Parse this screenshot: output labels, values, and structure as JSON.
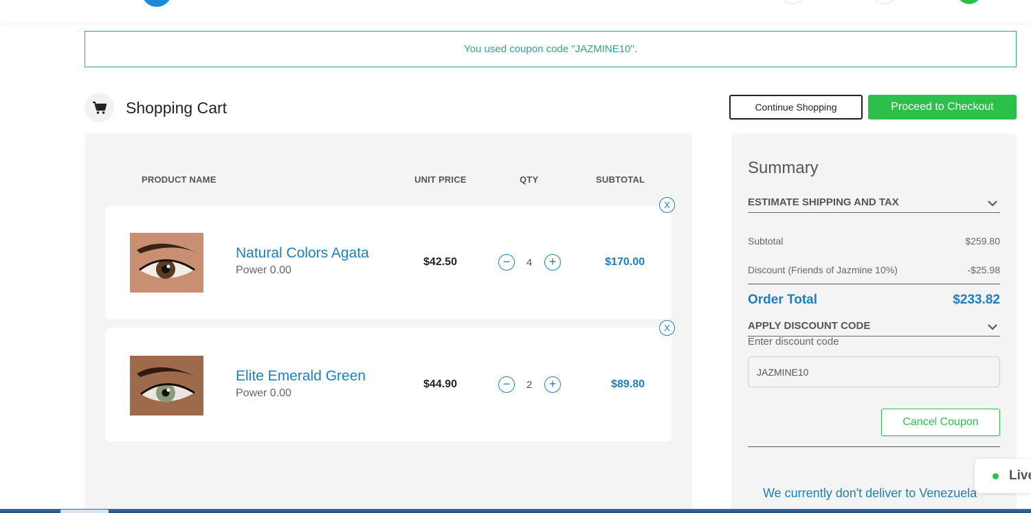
{
  "banner": {
    "message": "You used coupon code \"JAZMINE10\"."
  },
  "header": {
    "cart_icon": "cart-icon",
    "title": "Shopping Cart",
    "continue_label": "Continue Shopping",
    "checkout_label": "Proceed to Checkout"
  },
  "table": {
    "columns": [
      "PRODUCT NAME",
      "UNIT PRICE",
      "QTY",
      "SUBTOTAL"
    ]
  },
  "items": [
    {
      "name": "Natural Colors Agata",
      "power": "Power 0.00",
      "unit_price": "$42.50",
      "qty": "4",
      "subtotal": "$170.00",
      "remove": "X",
      "minus": "−",
      "plus": "+",
      "eye_color": "#5a3a22"
    },
    {
      "name": "Elite Emerald Green",
      "power": "Power 0.00",
      "unit_price": "$44.90",
      "qty": "2",
      "subtotal": "$89.80",
      "remove": "X",
      "minus": "−",
      "plus": "+",
      "eye_color": "#8a9a78"
    }
  ],
  "summary": {
    "title": "Summary",
    "estimate_label": "ESTIMATE SHIPPING AND TAX",
    "subtotal_label": "Subtotal",
    "subtotal_value": "$259.80",
    "discount_label": "Discount (Friends of Jazmine 10%)",
    "discount_value": "-$25.98",
    "total_label": "Order Total",
    "total_value": "$233.82",
    "apply_label": "APPLY DISCOUNT CODE",
    "code_label": "Enter discount code",
    "code_value": "JAZMINE10",
    "cancel_label": "Cancel Coupon",
    "deliver_msg": "We currently don't deliver to Venezuela"
  },
  "live_chat": {
    "label": "Live"
  },
  "colors": {
    "accent_blue": "#1a7fc1",
    "green": "#2cbf4a",
    "banner_teal": "#2aa889"
  }
}
